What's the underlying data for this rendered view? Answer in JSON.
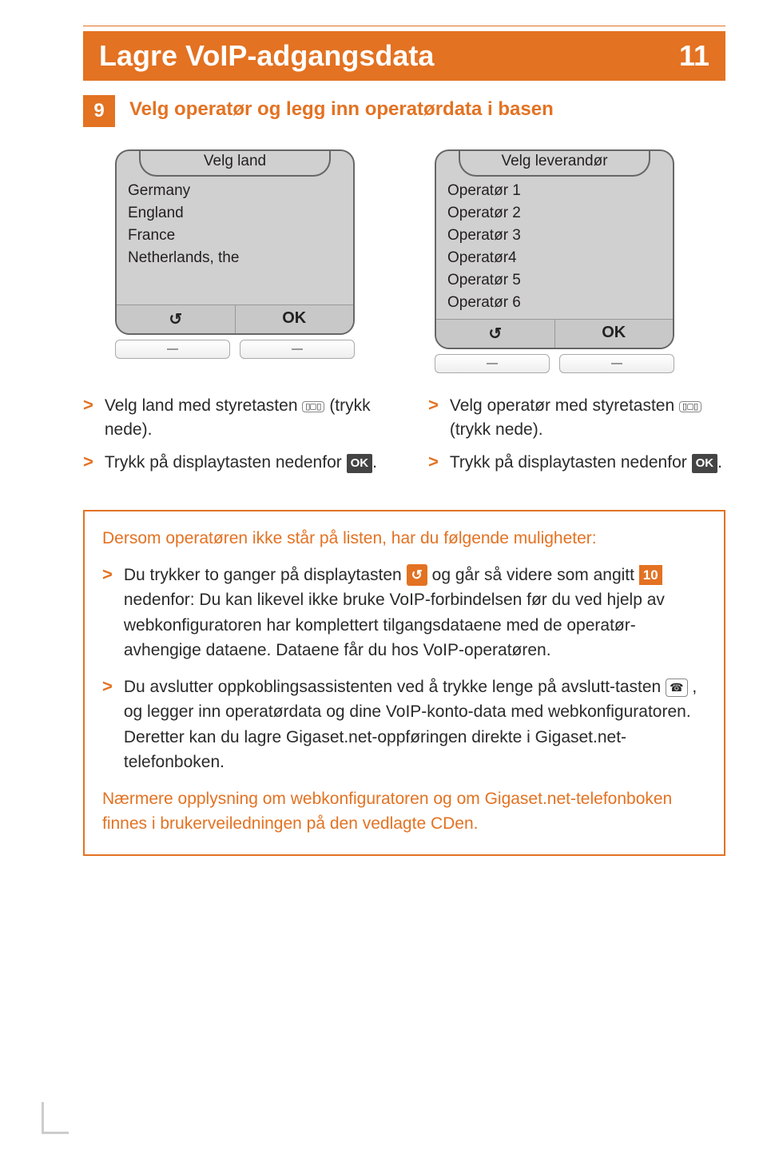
{
  "header": {
    "title": "Lagre VoIP-adgangsdata",
    "page_number": "11"
  },
  "step": {
    "number": "9",
    "title": "Velg operatør og legg inn operatørdata i basen"
  },
  "phone_left": {
    "header": "Velg land",
    "items": [
      "Germany",
      "England",
      "France",
      "Netherlands, the"
    ],
    "soft_left": "↺",
    "soft_right": "OK"
  },
  "phone_right": {
    "header": "Velg leverandør",
    "items": [
      "Operatør 1",
      "Operatør 2",
      "Operatør 3",
      "Operatør4",
      "Operatør 5",
      "Operatør 6"
    ],
    "soft_left": "↺",
    "soft_right": "OK"
  },
  "instr_left": {
    "i1a": "Velg land med styretasten ",
    "i1b": " (trykk nede).",
    "i2a": "Trykk på displaytasten nedenfor ",
    "i2b": ".",
    "ok": "OK"
  },
  "instr_right": {
    "i1a": "Velg operatør med styretasten ",
    "i1b": " (trykk nede).",
    "i2a": "Trykk på displaytasten nedenfor ",
    "i2b": ".",
    "ok": "OK"
  },
  "infobox": {
    "lead": "Dersom operatøren ikke står på listen, har du følgende muligheter:",
    "b1_a": "Du trykker to ganger på displaytasten ",
    "b1_back": "↺",
    "b1_b": " og går så videre som angitt ",
    "b1_num": "10",
    "b1_c": " nedenfor: Du kan likevel ikke bruke VoIP-forbindelsen før du ved hjelp av webkonfiguratoren har komplettert tilgangsdataene med de operatør-avhengige dataene. Dataene får du hos VoIP-operatøren.",
    "b2_a": "Du avslutter oppkoblingsassistenten ved å trykke lenge på avslutt-tasten ",
    "b2_hang": "☎",
    "b2_b": ", og legger inn operatørdata og dine VoIP-konto-data med webkonfiguratoren. Deretter kan du lagre Gigaset.net-oppføringen direkte i Gigaset.net-telefonboken.",
    "closing": "Nærmere opplysning om webkonfiguratoren og om Gigaset.net-telefonboken finnes i brukerveiledningen på den vedlagte CDen."
  }
}
